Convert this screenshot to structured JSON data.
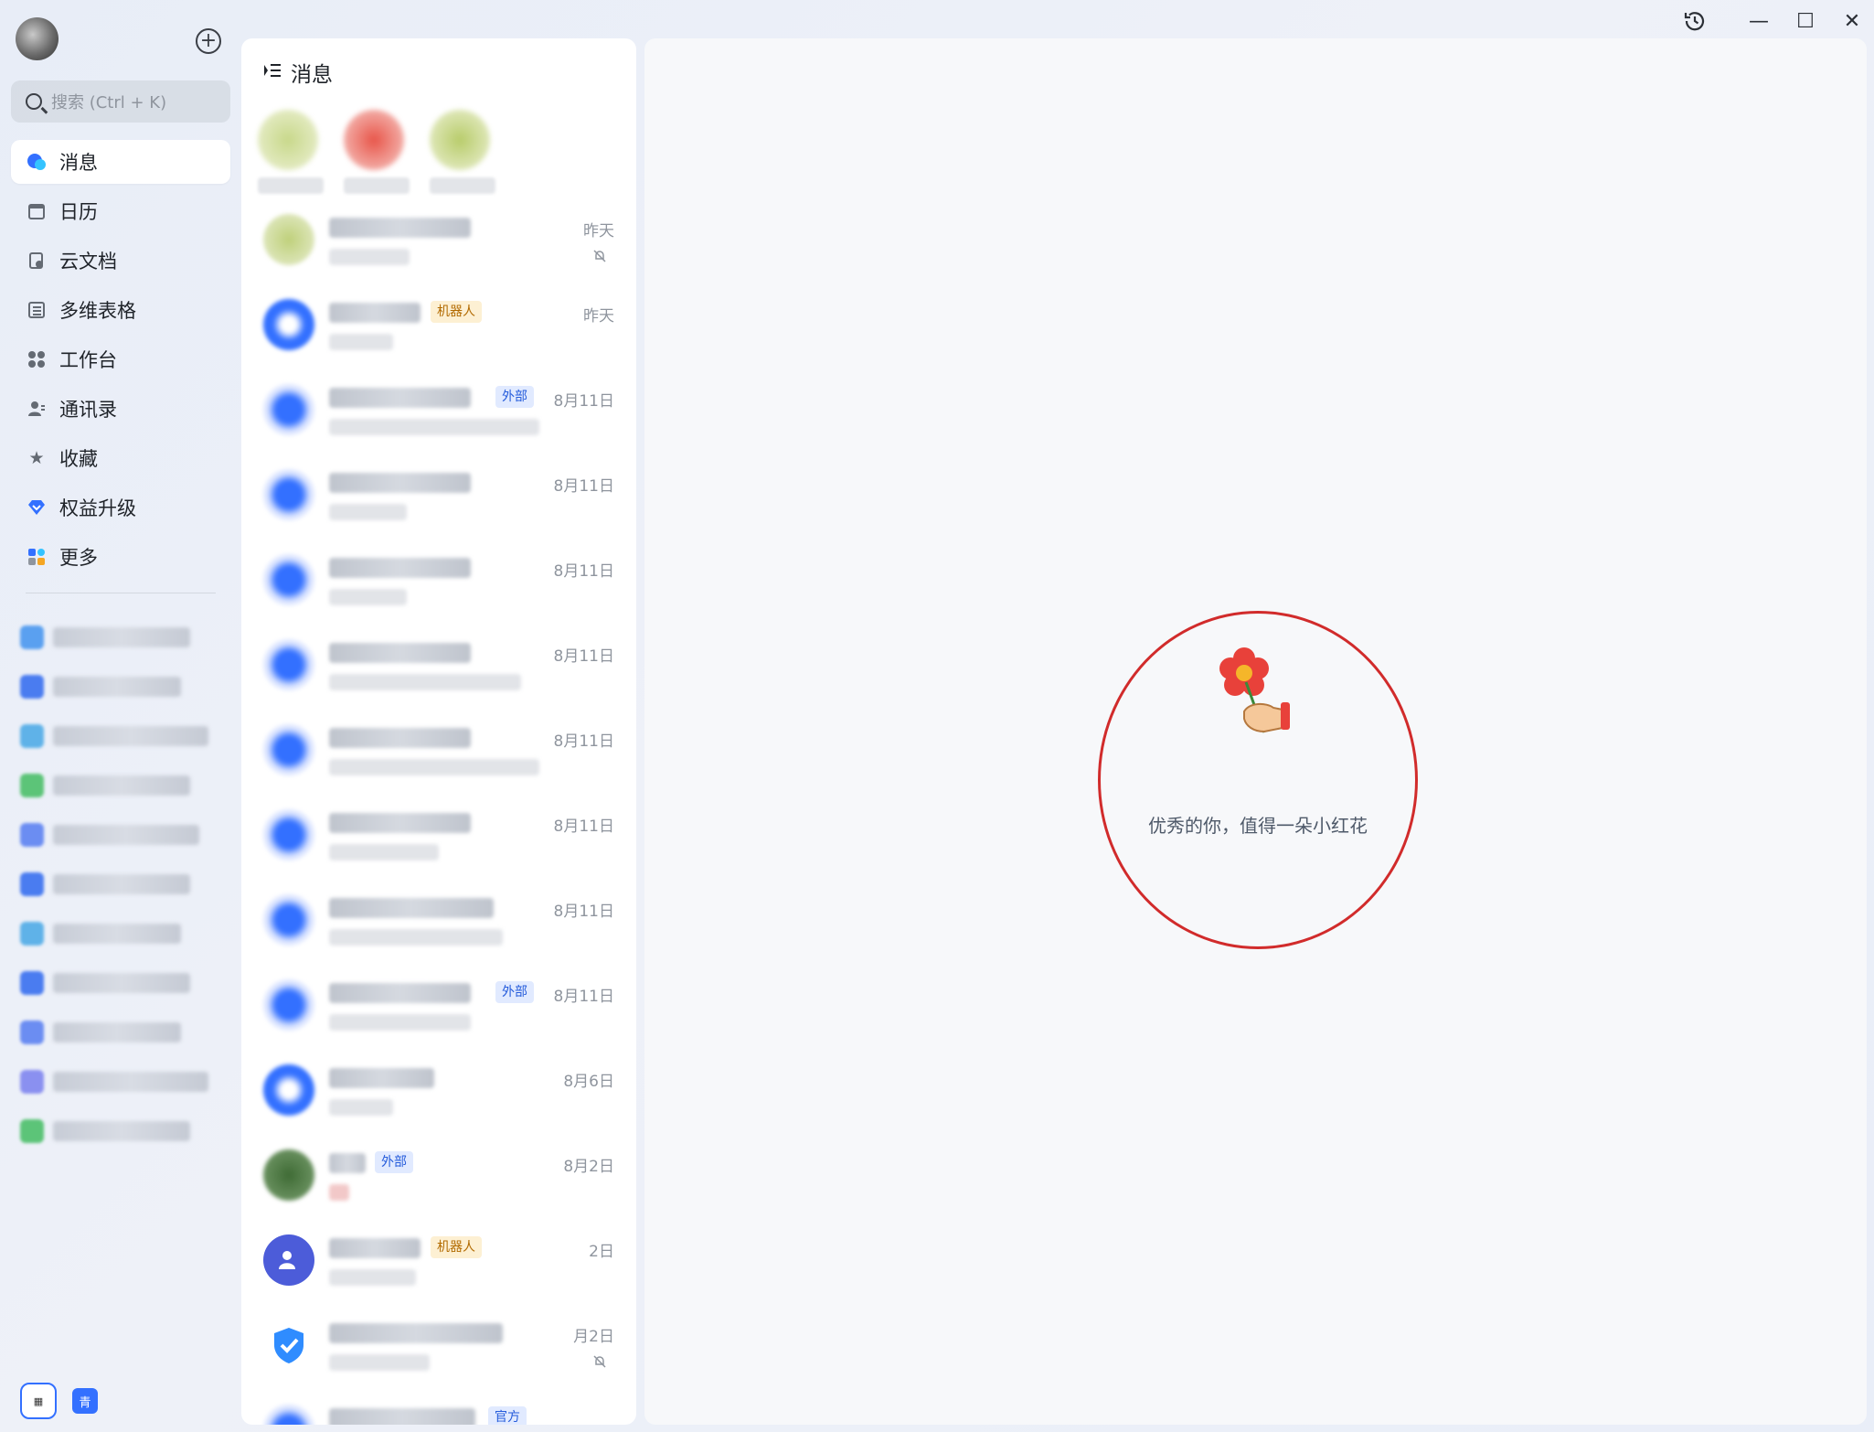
{
  "window": {
    "controls": {
      "history_icon": "history-clock-icon",
      "minimize_glyph": "—",
      "maximize_glyph": "☐",
      "close_glyph": "✕"
    }
  },
  "sidebar": {
    "add_glyph": "+",
    "search_placeholder": "搜索 (Ctrl + K)",
    "nav": [
      {
        "label": "消息",
        "icon": "message-bubble-icon",
        "active": true
      },
      {
        "label": "日历",
        "icon": "calendar-icon"
      },
      {
        "label": "云文档",
        "icon": "cloud-doc-icon"
      },
      {
        "label": "多维表格",
        "icon": "base-table-icon"
      },
      {
        "label": "工作台",
        "icon": "workplace-grid-icon"
      },
      {
        "label": "通讯录",
        "icon": "contacts-icon"
      },
      {
        "label": "收藏",
        "icon": "star-icon"
      },
      {
        "label": "权益升级",
        "icon": "diamond-icon"
      },
      {
        "label": "更多",
        "icon": "more-apps-icon"
      }
    ],
    "bottom": {
      "app_badge": "青"
    }
  },
  "chatlist": {
    "title": "消息",
    "rows": [
      {
        "time": "昨天",
        "tag": "",
        "muted": true
      },
      {
        "time": "昨天",
        "tag": "机器人",
        "muted": false
      },
      {
        "time": "8月11日",
        "tag": "外部",
        "muted": false
      },
      {
        "time": "8月11日",
        "tag": "",
        "muted": false
      },
      {
        "time": "8月11日",
        "tag": "",
        "muted": false
      },
      {
        "time": "8月11日",
        "tag": "",
        "muted": false
      },
      {
        "time": "8月11日",
        "tag": "",
        "muted": false
      },
      {
        "time": "8月11日",
        "tag": "",
        "muted": false
      },
      {
        "time": "8月11日",
        "tag": "",
        "muted": false
      },
      {
        "time": "8月11日",
        "tag": "外部",
        "muted": false
      },
      {
        "time": "8月6日",
        "tag": "",
        "muted": false
      },
      {
        "time": "8月2日",
        "tag": "外部",
        "muted": false
      },
      {
        "time": "2日",
        "tag": "机器人",
        "muted": false
      },
      {
        "time": "月2日",
        "tag": "",
        "muted": true
      },
      {
        "time": "",
        "tag": "官方",
        "muted": false
      }
    ]
  },
  "main": {
    "empty_text": "优秀的你，值得一朵小红花"
  },
  "colors": {
    "accent": "#3370ff",
    "highlight_circle": "#d12b2b"
  }
}
